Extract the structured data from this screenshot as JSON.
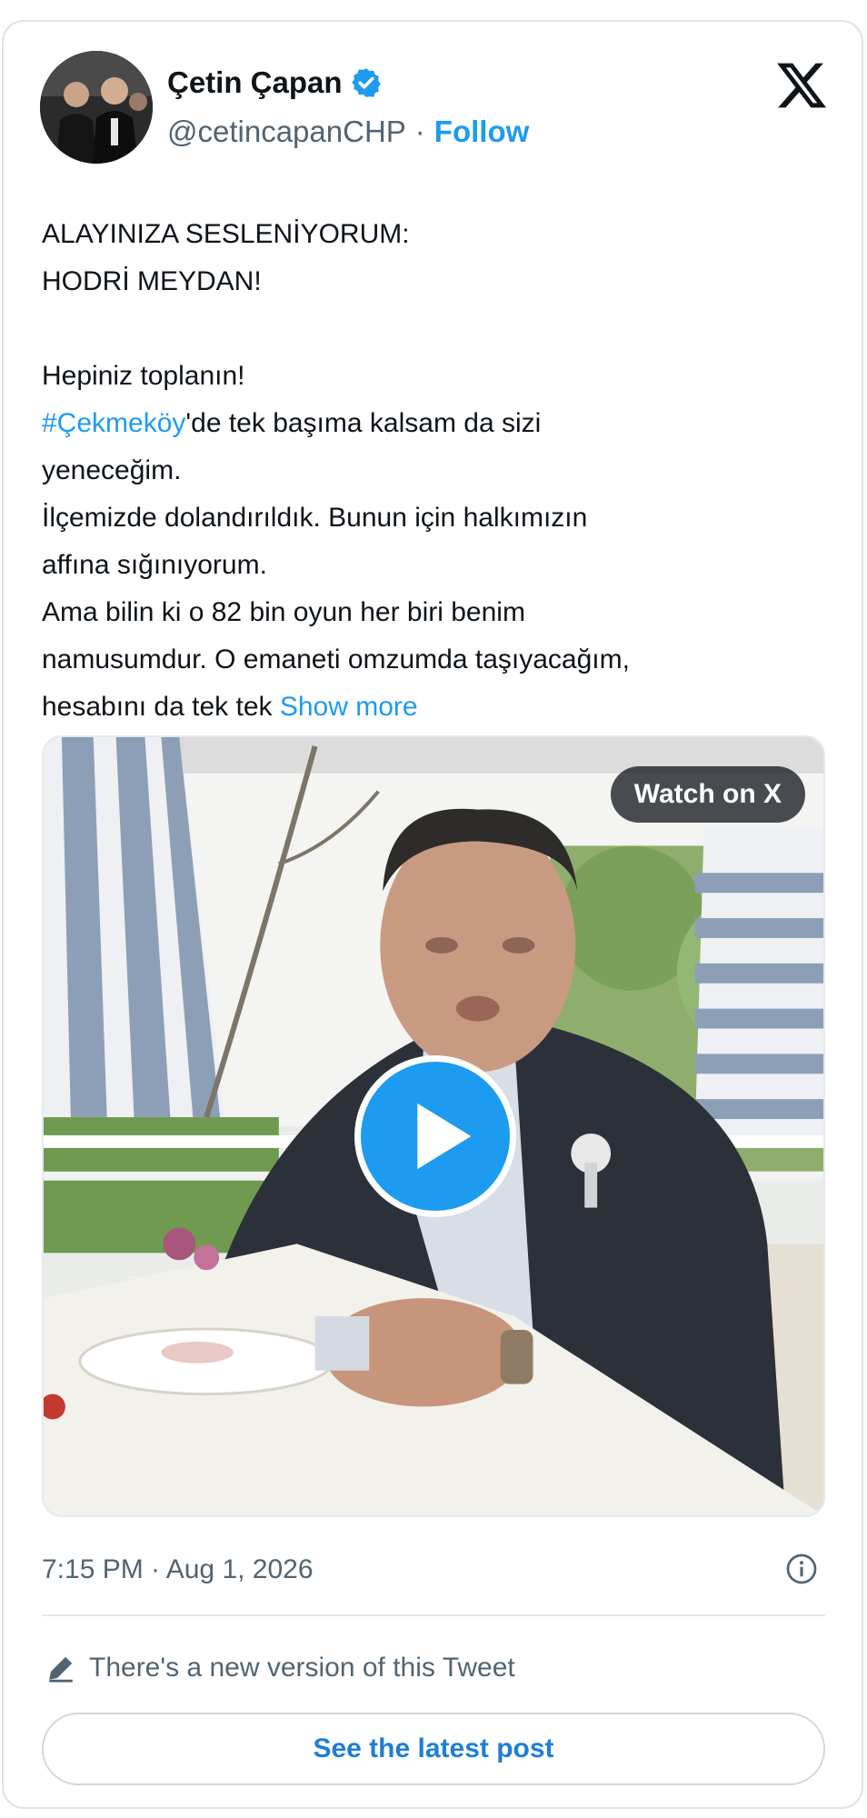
{
  "author": {
    "name": "Çetin Çapan",
    "handle": "@cetincapanCHP",
    "separator": "·",
    "follow_label": "Follow",
    "verified": true
  },
  "icons": {
    "verified": "verified-badge-icon",
    "platform": "x-logo-icon",
    "info": "info-icon",
    "edit": "pencil-icon",
    "play": "play-icon"
  },
  "tweet": {
    "line1": "ALAYINIZA SESLENİYORUM:",
    "line2": "HODRİ MEYDAN!",
    "line3": "Hepiniz toplanın!",
    "hashtag": "#Çekmeköy",
    "line4_rest": "'de tek başıma kalsam da sizi",
    "line5": "yeneceğim.",
    "line6": "İlçemizde dolandırıldık. Bunun için halkımızın",
    "line7": "affına sığınıyorum.",
    "line8": "Ama bilin ki o 82 bin oyun her biri benim",
    "line9": "namusumdur. O emaneti omzumda taşıyacağım,",
    "line10": "hesabını da tek tek",
    "show_more": "Show more"
  },
  "media": {
    "watch_label": "Watch on X"
  },
  "footer": {
    "timestamp": "7:15 PM · Aug 1, 2026",
    "new_version_text": "There's a new version of this Tweet",
    "see_latest_label": "See the latest post"
  },
  "colors": {
    "accent": "#1d9bf0",
    "text_primary": "#0f1419",
    "text_secondary": "#536471",
    "border": "#dfe3e7"
  }
}
